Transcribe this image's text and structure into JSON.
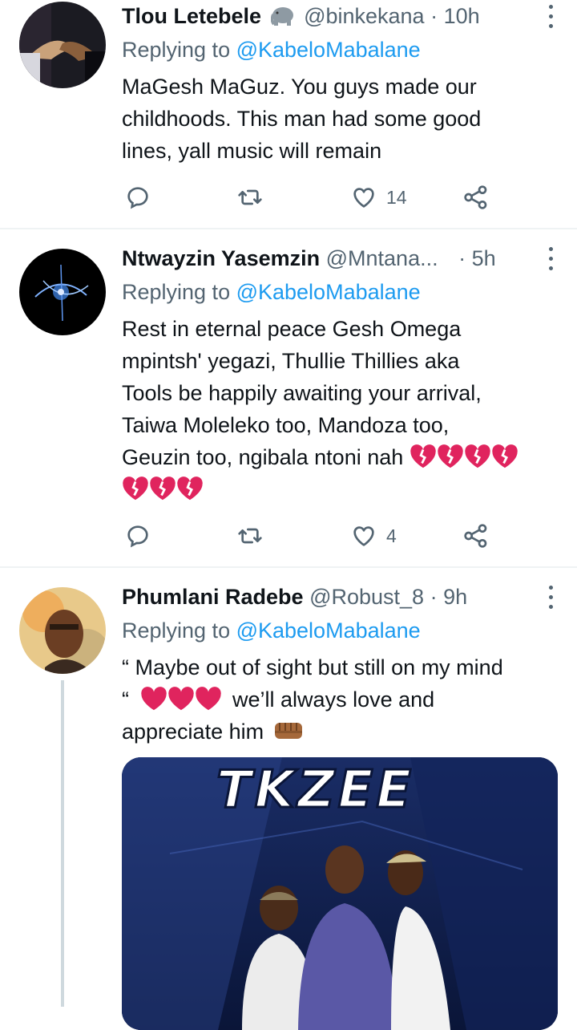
{
  "tweets": [
    {
      "name": "Tlou Letebele",
      "handle": "@binkekana",
      "time": "10h",
      "replying_prefix": "Replying to ",
      "replying_to": "@KabeloMabalane",
      "lines": [
        "MaGesh MaGuz. You guys made our",
        "childhoods. This man had some good",
        "lines, yall music will remain"
      ],
      "likes": "14"
    },
    {
      "name": "Ntwayzin Yasemzin",
      "handle": "@Mntana...",
      "time": "5h",
      "replying_prefix": "Replying to ",
      "replying_to": "@KabeloMabalane",
      "lines": [
        "Rest in eternal peace Gesh Omega",
        "mpintsh' yegazi, Thullie Thillies aka",
        "Tools be happily awaiting your arrival,",
        "Taiwa Moleleko too, Mandoza too,",
        "Geuzin too, ngibala ntoni nah"
      ],
      "likes": "4"
    },
    {
      "name": "Phumlani Radebe",
      "handle": "@Robust_8",
      "time": "9h",
      "replying_prefix": "Replying to ",
      "replying_to": "@KabeloMabalane",
      "line1": "“ Maybe out of sight but still on my mind",
      "line2_open": "“",
      "line2_text": "we’ll always love and",
      "line3": "appreciate him",
      "media_title": "TKZEE"
    }
  ],
  "separator": "·",
  "colors": {
    "link": "#1d9bf0",
    "muted": "#536471",
    "heart": "#e0245e"
  }
}
